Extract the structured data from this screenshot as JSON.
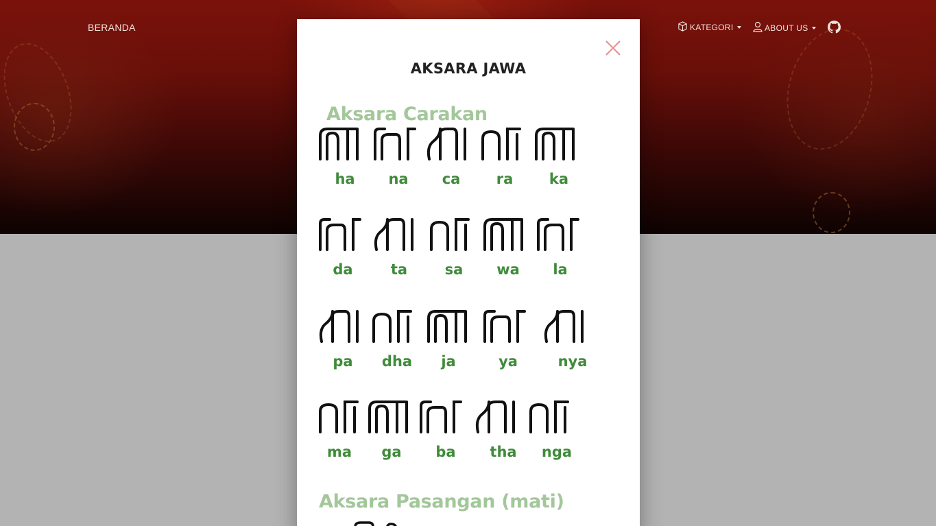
{
  "nav": {
    "home": "BERANDA",
    "kategori": "KATEGORI",
    "about": "ABOUT US",
    "kategori_icon": "cube-icon",
    "about_icon": "user-icon",
    "github_icon": "github-icon"
  },
  "modal": {
    "title": "AKSARA JAWA",
    "close_icon": "close-icon",
    "close_color": "#e98a8a"
  },
  "chart": {
    "section1": "Aksara Carakan",
    "section2": "Aksara Pasangan (mati)",
    "heading_color": "#a3c79a",
    "label_color": "#3f8b3a",
    "rows": [
      [
        "ha",
        "na",
        "ca",
        "ra",
        "ka"
      ],
      [
        "da",
        "ta",
        "sa",
        "wa",
        "la"
      ],
      [
        "pa",
        "dha",
        "ja",
        "ya",
        "nya"
      ],
      [
        "ma",
        "ga",
        "ba",
        "tha",
        "nga"
      ]
    ]
  }
}
